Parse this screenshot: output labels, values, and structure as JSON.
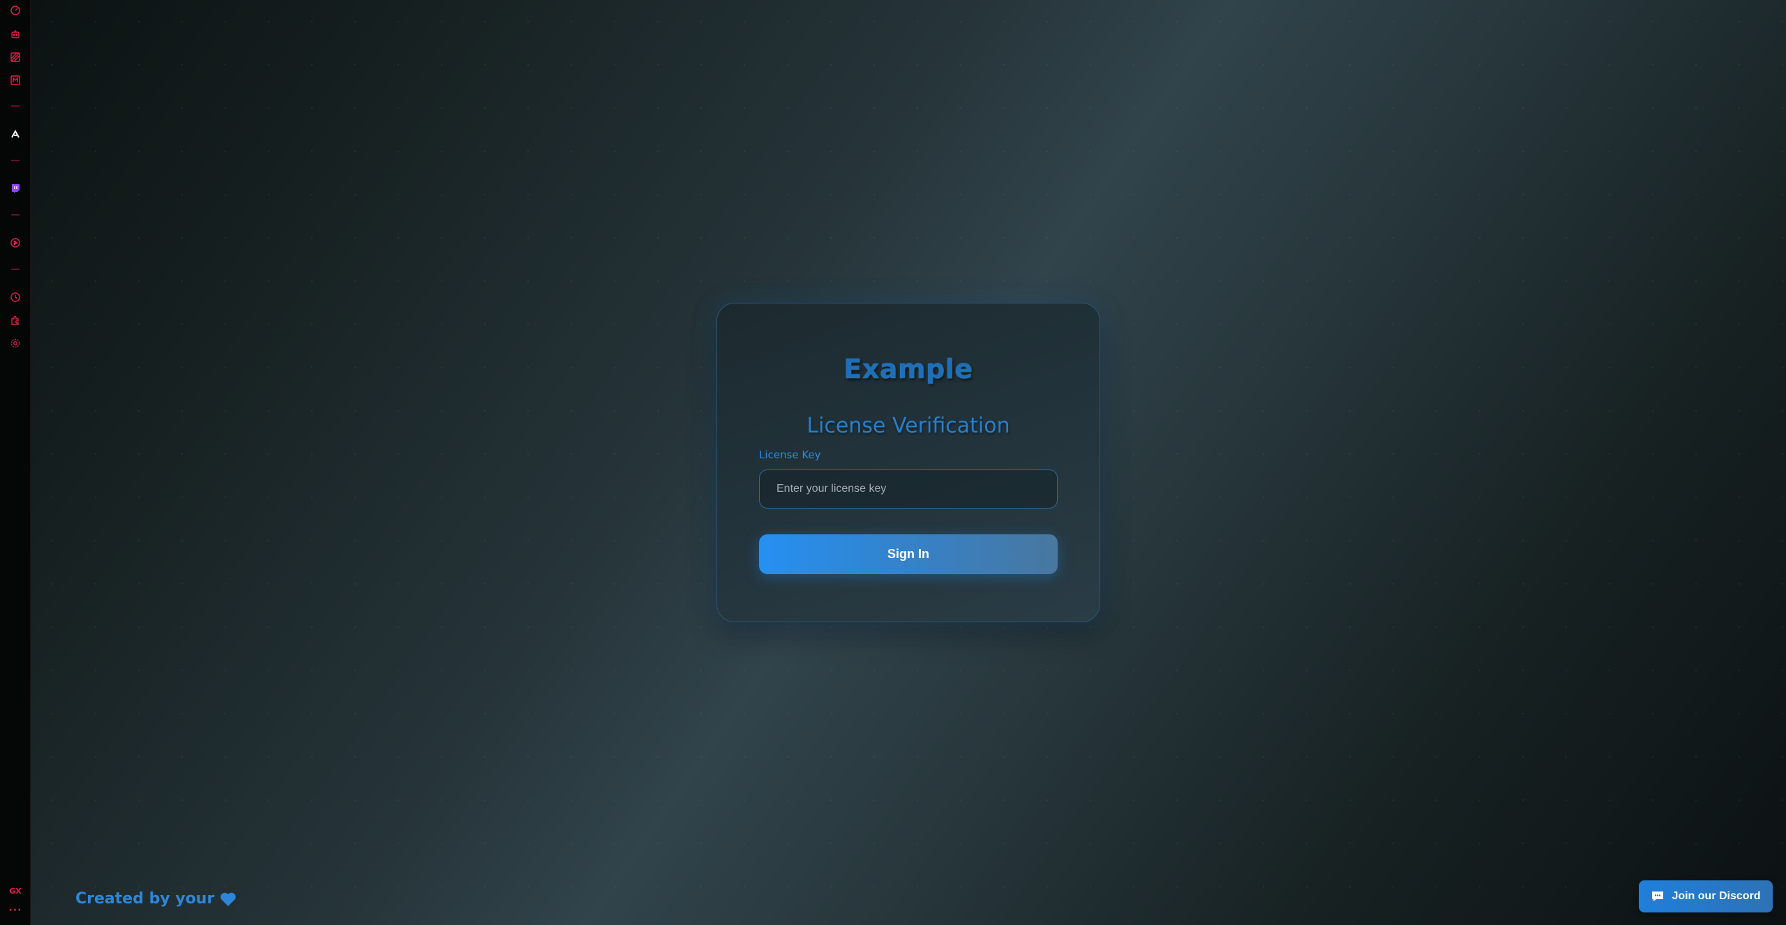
{
  "sidebar": {
    "accent_color": "#e0204a",
    "items": [
      {
        "icon": "speed-dial-icon"
      },
      {
        "icon": "bot-icon"
      },
      {
        "icon": "stripes-icon"
      },
      {
        "icon": "mail-icon"
      },
      {
        "icon": "aria-icon"
      },
      {
        "icon": "twitch-icon"
      },
      {
        "icon": "player-icon"
      },
      {
        "icon": "history-icon"
      },
      {
        "icon": "extensions-icon"
      },
      {
        "icon": "settings-icon"
      }
    ],
    "gx_label": "GX",
    "more_label": "···"
  },
  "card": {
    "brand": "Example",
    "heading": "License Verification",
    "field_label": "License Key",
    "input_value": "",
    "input_placeholder": "Enter your license key",
    "submit_label": "Sign In"
  },
  "footer": {
    "credit_text": "Created by your",
    "credit_icon": "heart-icon",
    "discord_label": "Join our Discord",
    "discord_icon": "chat-bubble-icon"
  },
  "colors": {
    "accent_blue": "#2590f2",
    "sidebar_red": "#e0204a"
  }
}
